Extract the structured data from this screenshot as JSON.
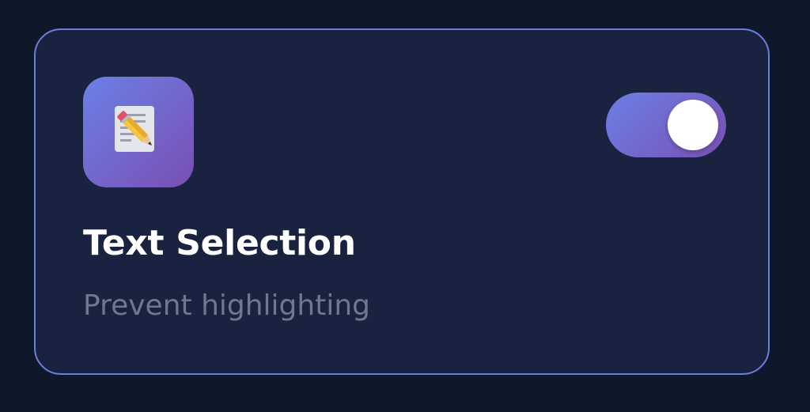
{
  "card": {
    "icon": "memo-pencil-icon",
    "title": "Text Selection",
    "description": "Prevent highlighting",
    "toggle": {
      "state": "on"
    }
  },
  "colors": {
    "background": "#0f172a",
    "card_background": "#19223f",
    "card_border": "#6a7fd8",
    "accent_start": "#6b80e6",
    "accent_end": "#7a4fb2",
    "title_text": "#ffffff",
    "description_text": "#6f7891"
  }
}
